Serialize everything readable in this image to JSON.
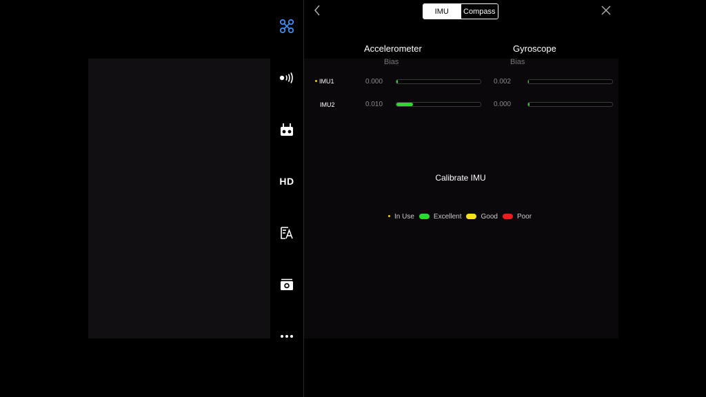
{
  "header": {
    "tabs": [
      {
        "label": "IMU",
        "active": true
      },
      {
        "label": "Compass",
        "active": false
      }
    ]
  },
  "sidebar": {
    "items": [
      {
        "name": "aircraft",
        "icon": "drone-icon",
        "color": "#3f8ef3"
      },
      {
        "name": "signal",
        "icon": "wireless-signal-icon"
      },
      {
        "name": "remote",
        "icon": "remote-controller-icon"
      },
      {
        "name": "hd",
        "label": "HD"
      },
      {
        "name": "battery",
        "icon": "battery-settings-icon"
      },
      {
        "name": "camera",
        "icon": "camera-icon"
      },
      {
        "name": "more",
        "icon": "more-icon"
      }
    ]
  },
  "imu": {
    "accelerometer_title": "Accelerometer",
    "accelerometer_sub": "Bias",
    "gyroscope_title": "Gyroscope",
    "gyroscope_sub": "Bias",
    "rows": [
      {
        "label": "IMU1",
        "in_use": true,
        "accel_value": "0.000",
        "accel_level": 0.0,
        "gyro_value": "0.002",
        "gyro_level": 0.005
      },
      {
        "label": "IMU2",
        "in_use": false,
        "accel_value": "0.010",
        "accel_level": 0.2,
        "gyro_value": "0.000",
        "gyro_level": 0.0
      }
    ],
    "calibrate_label": "Calibrate IMU"
  },
  "legend": {
    "in_use": "In Use",
    "excellent": "Excellent",
    "good": "Good",
    "poor": "Poor",
    "colors": {
      "in_use": "#f0d200",
      "excellent": "#2fd92a",
      "good": "#f4e11a",
      "poor": "#ee1c1c"
    }
  }
}
